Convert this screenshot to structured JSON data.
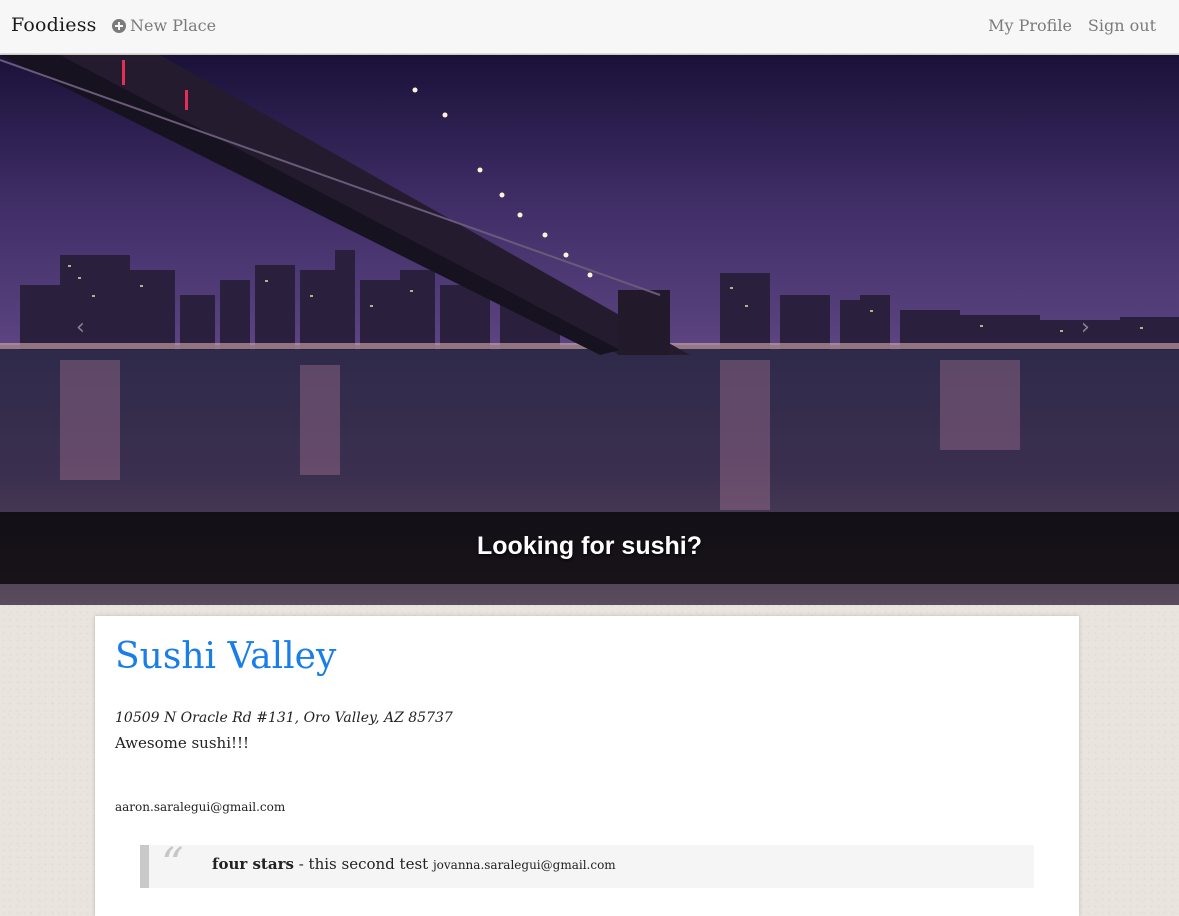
{
  "navbar": {
    "brand": "Foodiess",
    "new_place_label": "New Place",
    "new_place_icon": "plus-circle-icon",
    "profile_label": "My Profile",
    "signout_label": "Sign out"
  },
  "carousel": {
    "caption": "Looking for sushi?",
    "prev_icon": "chevron-left-icon",
    "next_icon": "chevron-right-icon",
    "prev_glyph": "‹",
    "next_glyph": "›"
  },
  "place": {
    "title": "Sushi Valley",
    "address": "10509 N Oracle Rd #131, Oro Valley, AZ 85737",
    "description": "Awesome sushi!!!",
    "owner_email": "aaron.saralegui@gmail.com"
  },
  "review": {
    "quote_glyph": "“",
    "rating": "four stars",
    "separator": " - ",
    "text": "this second test",
    "author_email": "jovanna.saralegui@gmail.com"
  },
  "colors": {
    "title": "#1a7ee8",
    "nav_text": "#7b7b7b",
    "caption_bar": "#000000"
  }
}
